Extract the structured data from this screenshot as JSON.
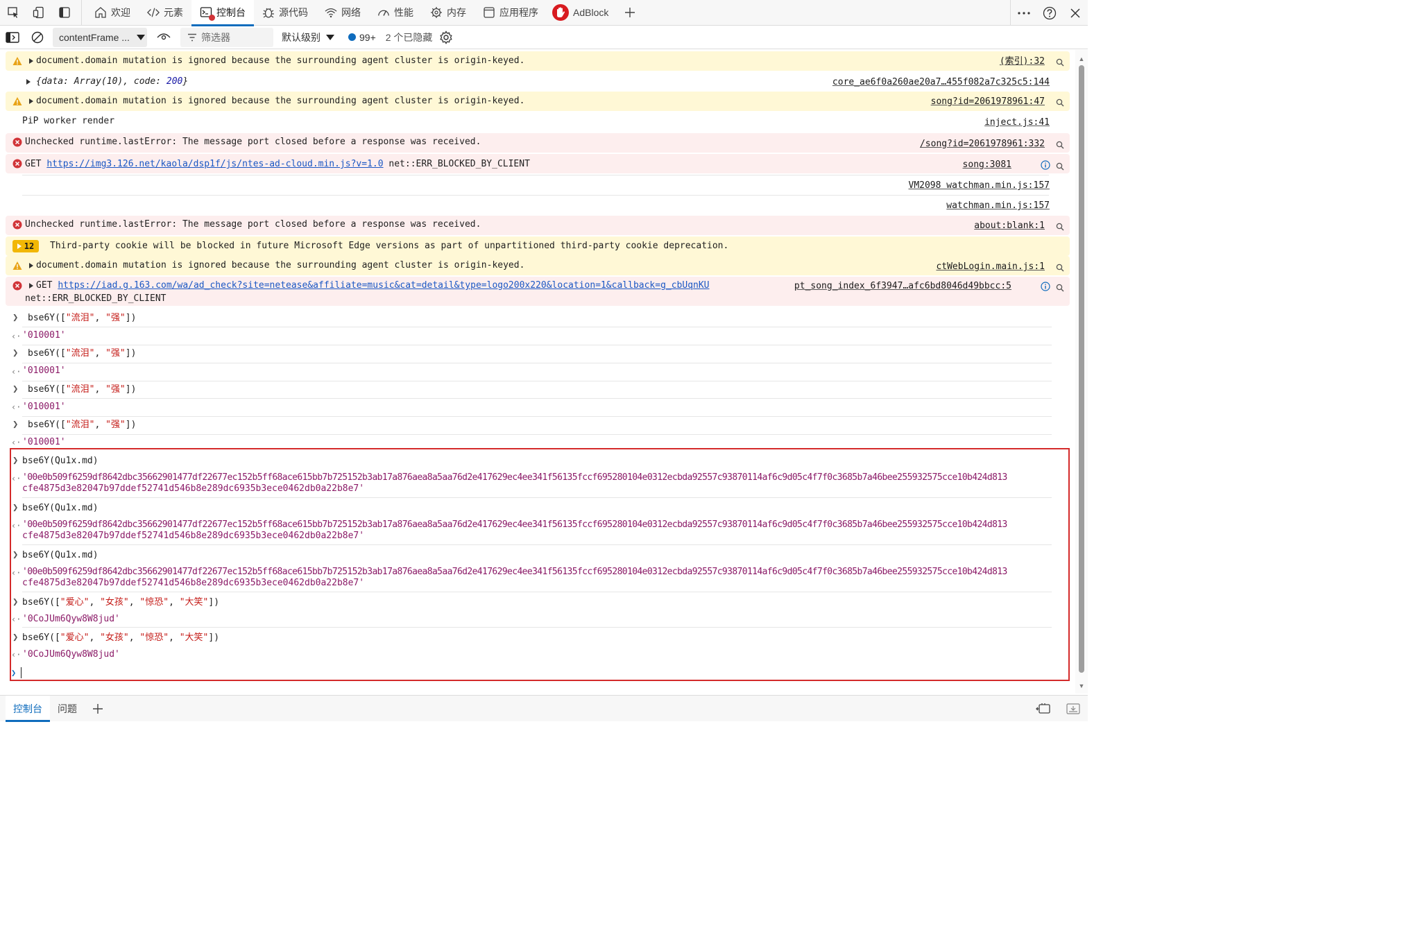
{
  "topbar": {
    "tabs": [
      {
        "label": "欢迎",
        "icon": "home-icon"
      },
      {
        "label": "元素",
        "icon": "code-icon"
      },
      {
        "label": "控制台",
        "icon": "console-icon"
      },
      {
        "label": "源代码",
        "icon": "bug-icon"
      },
      {
        "label": "网络",
        "icon": "wifi-icon"
      },
      {
        "label": "性能",
        "icon": "gauge-icon"
      },
      {
        "label": "内存",
        "icon": "chip-icon"
      },
      {
        "label": "应用程序",
        "icon": "app-window-icon"
      },
      {
        "label": "AdBlock",
        "icon": "adblock-icon"
      }
    ],
    "active_tab": "控制台"
  },
  "toolbar": {
    "context": "contentFrame ...",
    "filter_placeholder": "筛选器",
    "level": "默认级别",
    "message_count": "99+",
    "hidden": "2 个已隐藏"
  },
  "messages": [
    {
      "type": "warn",
      "text": "document.domain mutation is ignored because the surrounding agent cluster is origin-keyed.",
      "source": "(索引):32"
    },
    {
      "type": "log",
      "text_prefix": "{data: ",
      "text_mid": "Array(10)",
      "text_code": ", code: ",
      "text_num": "200",
      "text_suffix": "}",
      "source": "core_ae6f0a260ae20a7…455f082a7c325c5:144"
    },
    {
      "type": "warn",
      "text": "document.domain mutation is ignored because the surrounding agent cluster is origin-keyed.",
      "source": "song?id=2061978961:47"
    },
    {
      "type": "log",
      "text": "PiP worker render",
      "source": "inject.js:41"
    },
    {
      "type": "error",
      "text": "Unchecked runtime.lastError: The message port closed before a response was received.",
      "source": "/song?id=2061978961:332"
    },
    {
      "type": "error",
      "method": "GET",
      "url": "https://img3.126.net/kaola/dsp1f/js/ntes-ad-cloud.min.js?v=1.0",
      "suffix": "net::ERR_BLOCKED_BY_CLIENT",
      "source": "song:3081"
    },
    {
      "type": "stack",
      "source": "VM2098 watchman.min.js:157"
    },
    {
      "type": "stack",
      "source": "watchman.min.js:157"
    },
    {
      "type": "error",
      "text": "Unchecked runtime.lastError: The message port closed before a response was received.",
      "source": "about:blank:1"
    },
    {
      "type": "issue",
      "badge": "12",
      "text": "Third-party cookie will be blocked in future Microsoft Edge versions as part of unpartitioned third-party cookie deprecation."
    },
    {
      "type": "warn",
      "text": "document.domain mutation is ignored because the surrounding agent cluster is origin-keyed.",
      "source": "ctWebLogin.main.js:1"
    },
    {
      "type": "error",
      "method": "GET",
      "url": "https://iad.g.163.com/wa/ad_check?site=netease&affiliate=music&cat=detail&type=logo200x220&location=1&callback=g_cbUqnKU",
      "suffix": "net::ERR_BLOCKED_BY_CLIENT",
      "source": "pt_song_index_6f3947…afc6bd8046d49bbcc:5"
    }
  ],
  "repl": [
    {
      "cmd_fn": "bse6Y([",
      "cmd_args": [
        "\"流泪\"",
        "\"强\""
      ],
      "cmd_end": "])",
      "result": "'010001'"
    },
    {
      "cmd_fn": "bse6Y([",
      "cmd_args": [
        "\"流泪\"",
        "\"强\""
      ],
      "cmd_end": "])",
      "result": "'010001'"
    },
    {
      "cmd_fn": "bse6Y([",
      "cmd_args": [
        "\"流泪\"",
        "\"强\""
      ],
      "cmd_end": "])",
      "result": "'010001'"
    },
    {
      "cmd_fn": "bse6Y([",
      "cmd_args": [
        "\"流泪\"",
        "\"强\""
      ],
      "cmd_end": "])",
      "result": "'010001'"
    }
  ],
  "highlighted": {
    "hash_line1": "'00e0b509f6259df8642dbc35662901477df22677ec152b5ff68ace615bb7b725152b3ab17a876aea8a5aa76d2e417629ec4ee341f56135fccf695280104e0312ecbda92557c93870114af6c9d05c4f7f0c3685b7a46bee255932575cce10b424d813",
    "hash_line2": "cfe4875d3e82047b97ddef52741d546b8e289dc6935b3ece0462db0a22b8e7'",
    "cmd_md": "bse6Y(Qu1x.md)",
    "cmd_emoji_fn": "bse6Y([",
    "cmd_emoji_args": [
      "\"爱心\"",
      "\"女孩\"",
      "\"惊恐\"",
      "\"大笑\""
    ],
    "cmd_emoji_end": "])",
    "emoji_result": "'0CoJUm6Qyw8W8jud'"
  },
  "bottombar": {
    "tabs": [
      "控制台",
      "问题"
    ],
    "active": "控制台"
  },
  "colors": {
    "accent": "#0f6cbd",
    "warn_bg": "#fff8d6",
    "error_bg": "#fdeeee",
    "highlight_border": "#d42a2a",
    "string": "#8b1a67"
  }
}
